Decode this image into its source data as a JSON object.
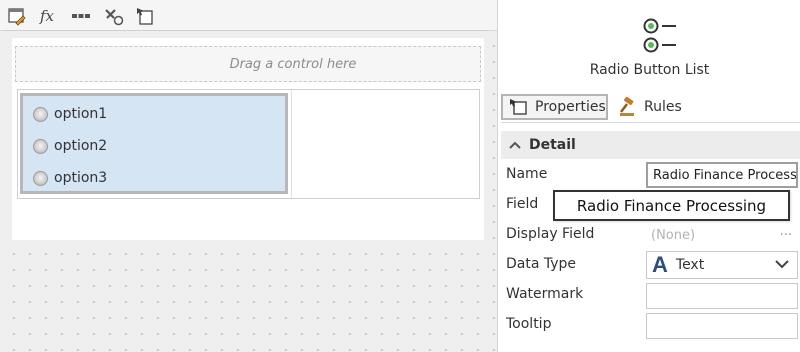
{
  "toolbar": {
    "buttons": [
      {
        "icon": "edit-form-icon"
      },
      {
        "icon": "expression-fx-icon",
        "glyph": "fx"
      },
      {
        "icon": "more-dots-icon"
      },
      {
        "icon": "tools-refresh-icon"
      },
      {
        "icon": "pointer-properties-icon"
      }
    ]
  },
  "designer": {
    "drop_zone_text": "Drag a control here",
    "radio_list": {
      "options": [
        "option1",
        "option2",
        "option3"
      ]
    }
  },
  "panel": {
    "control_icon": "radio-button-list-icon",
    "control_title": "Radio Button List",
    "tabs": [
      {
        "label": "Properties",
        "icon": "properties-icon",
        "active": true
      },
      {
        "label": "Rules",
        "icon": "rules-gavel-icon",
        "active": false
      }
    ],
    "section": {
      "title": "Detail",
      "expanded": true
    },
    "properties": {
      "name_label": "Name",
      "name_value": "Radio Finance Process",
      "field_label": "Field",
      "field_popup": "Radio Finance Processing",
      "display_field_label": "Display Field",
      "display_field_value": "(None)",
      "display_field_more": "···",
      "data_type_label": "Data Type",
      "data_type_glyph": "A",
      "data_type_value": "Text",
      "watermark_label": "Watermark",
      "watermark_value": "",
      "tooltip_label": "Tooltip",
      "tooltip_value": ""
    }
  },
  "colors": {
    "selection_fill": "#d5e5f4",
    "data_type_icon": "#2d4f7c",
    "rules_icon": "#c77b2b"
  }
}
